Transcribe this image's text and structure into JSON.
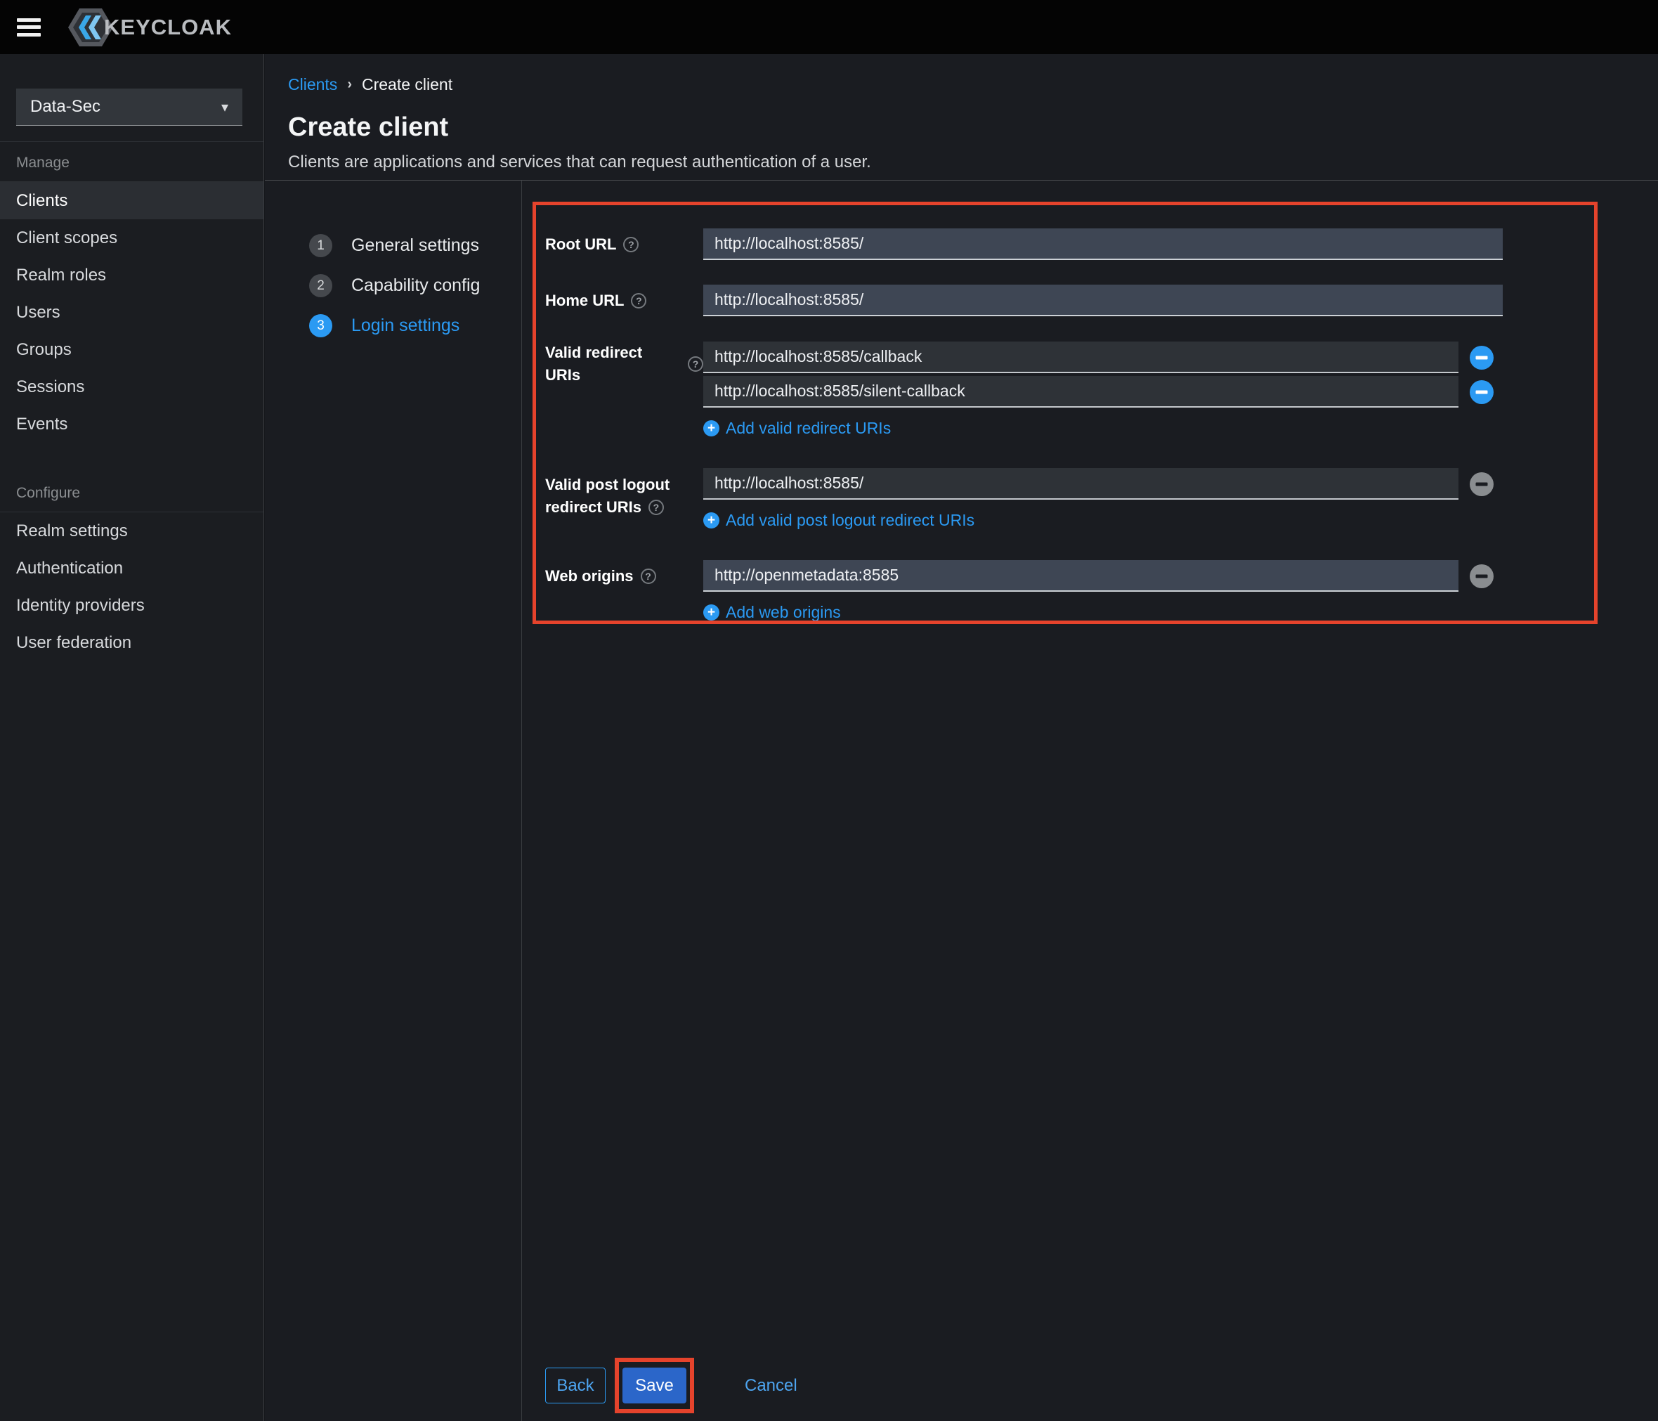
{
  "topbar": {
    "logo_text": "KEYCLOAK"
  },
  "sidebar": {
    "realm_selector": {
      "value": "Data-Sec"
    },
    "sections": [
      {
        "title": "Manage",
        "items": [
          {
            "label": "Clients",
            "active": true
          },
          {
            "label": "Client scopes",
            "active": false
          },
          {
            "label": "Realm roles",
            "active": false
          },
          {
            "label": "Users",
            "active": false
          },
          {
            "label": "Groups",
            "active": false
          },
          {
            "label": "Sessions",
            "active": false
          },
          {
            "label": "Events",
            "active": false
          }
        ]
      },
      {
        "title": "Configure",
        "items": [
          {
            "label": "Realm settings",
            "active": false
          },
          {
            "label": "Authentication",
            "active": false
          },
          {
            "label": "Identity providers",
            "active": false
          },
          {
            "label": "User federation",
            "active": false
          }
        ]
      }
    ]
  },
  "header": {
    "breadcrumb": {
      "parent": "Clients",
      "separator": "›",
      "current": "Create client"
    },
    "title": "Create client",
    "subtitle": "Clients are applications and services that can request authentication of a user."
  },
  "wizard": {
    "steps": [
      {
        "number": "1",
        "label": "General settings",
        "active": false
      },
      {
        "number": "2",
        "label": "Capability config",
        "active": false
      },
      {
        "number": "3",
        "label": "Login settings",
        "active": true
      }
    ]
  },
  "form": {
    "root_url": {
      "label": "Root URL",
      "value": "http://localhost:8585/"
    },
    "home_url": {
      "label": "Home URL",
      "value": "http://localhost:8585/"
    },
    "valid_redirect_uris": {
      "label": "Valid redirect URIs",
      "values": [
        "http://localhost:8585/callback",
        "http://localhost:8585/silent-callback"
      ],
      "add_label": "Add valid redirect URIs"
    },
    "valid_post_logout_redirect_uris": {
      "label_line1": "Valid post logout",
      "label_line2": "redirect URIs",
      "values": [
        "http://localhost:8585/"
      ],
      "add_label": "Add valid post logout redirect URIs"
    },
    "web_origins": {
      "label": "Web origins",
      "values": [
        "http://openmetadata:8585"
      ],
      "add_label": "Add web origins"
    },
    "help_glyph": "?",
    "plus_glyph": "+"
  },
  "footer": {
    "back_label": "Back",
    "save_label": "Save",
    "cancel_label": "Cancel"
  },
  "colors": {
    "link_blue": "#2b9af3",
    "primary_button_blue": "#2b66c9",
    "highlight_red": "#e5432c",
    "input_light_bg": "#3e4654",
    "input_dark_bg": "#2e3237",
    "topbar_bg": "#040404",
    "sidebar_bg": "#1b1d21",
    "main_bg": "#1a1c21"
  }
}
